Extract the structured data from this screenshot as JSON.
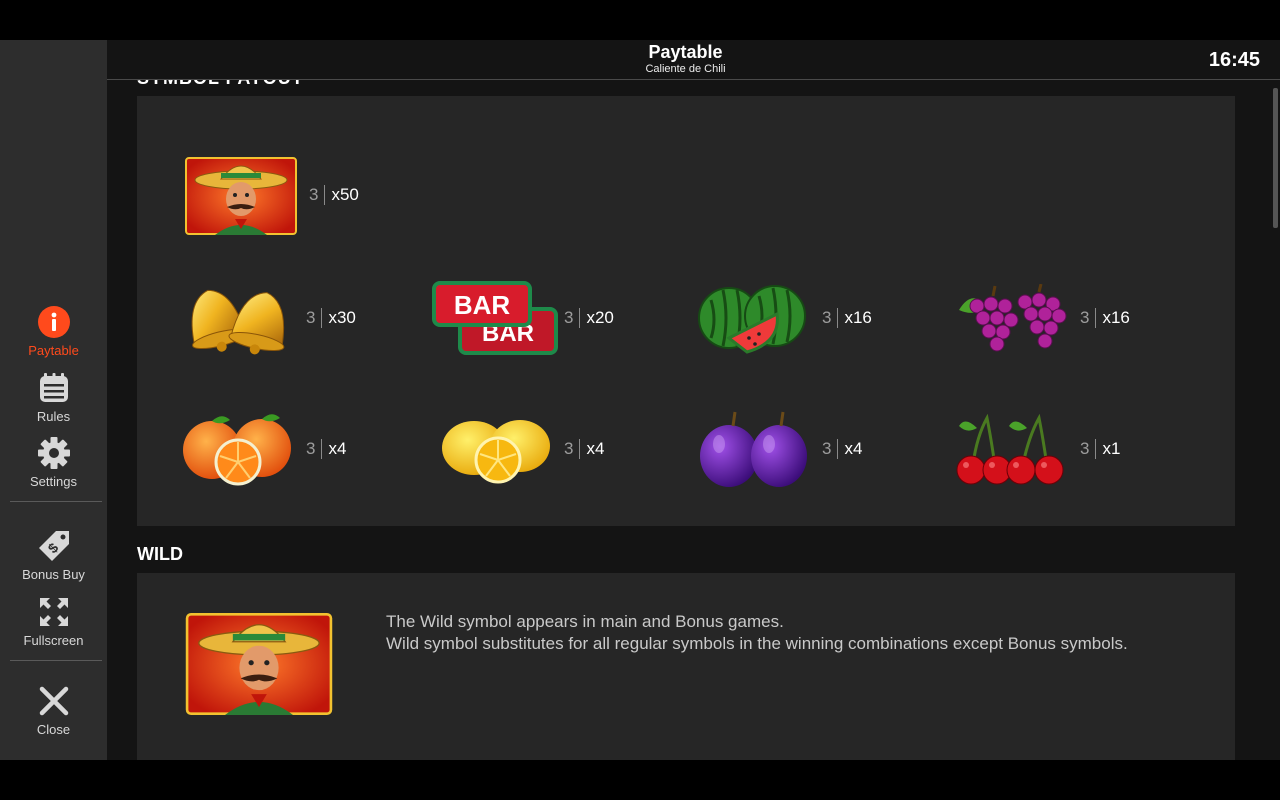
{
  "header": {
    "title": "Paytable",
    "subtitle": "Caliente de Chili",
    "clock": "16:45"
  },
  "sidebar": {
    "items": [
      {
        "label": "Paytable",
        "icon": "info-icon",
        "active": true
      },
      {
        "label": "Rules",
        "icon": "notepad-icon",
        "active": false
      },
      {
        "label": "Settings",
        "icon": "gear-icon",
        "active": false
      },
      {
        "label": "Bonus Buy",
        "icon": "price-tag-dollar-icon",
        "active": false
      },
      {
        "label": "Fullscreen",
        "icon": "fullscreen-arrows-icon",
        "active": false
      },
      {
        "label": "Close",
        "icon": "close-x-icon",
        "active": false
      }
    ],
    "active_color": "#ff4a1c"
  },
  "payouts": {
    "symbols": [
      {
        "name": "wild-mariachi",
        "count": "3",
        "multiplier": "x50"
      },
      {
        "name": "golden-bells",
        "count": "3",
        "multiplier": "x30"
      },
      {
        "name": "double-bar",
        "count": "3",
        "multiplier": "x20",
        "bar_text": "BAR"
      },
      {
        "name": "watermelon",
        "count": "3",
        "multiplier": "x16"
      },
      {
        "name": "grapes",
        "count": "3",
        "multiplier": "x16"
      },
      {
        "name": "oranges",
        "count": "3",
        "multiplier": "x4"
      },
      {
        "name": "lemons",
        "count": "3",
        "multiplier": "x4"
      },
      {
        "name": "plums",
        "count": "3",
        "multiplier": "x4"
      },
      {
        "name": "cherries",
        "count": "3",
        "multiplier": "x1"
      }
    ]
  },
  "wild": {
    "title": "WILD",
    "line1": "The Wild symbol appears in main and Bonus games.",
    "line2": "Wild symbol substitutes for all regular symbols in the winning combinations except Bonus symbols."
  }
}
